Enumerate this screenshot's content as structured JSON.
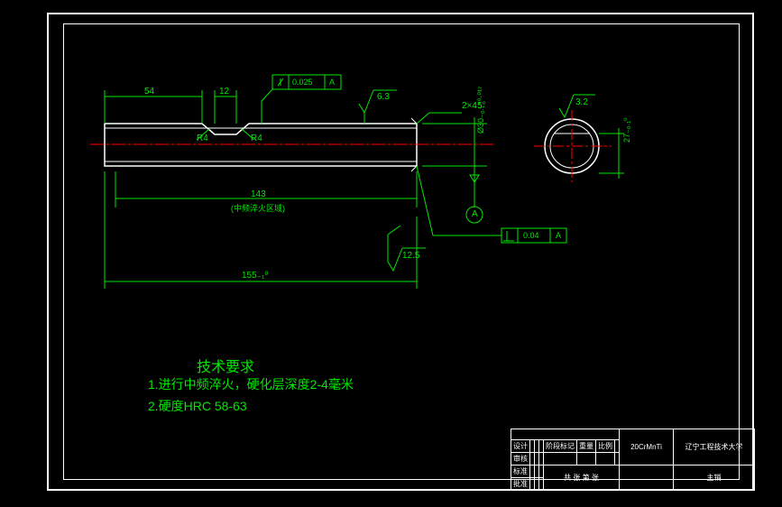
{
  "dims": {
    "d54": "54",
    "d12": "12",
    "r4a": "R4",
    "r4b": "R4",
    "d143": "143",
    "d143note": "(中频淬火区域)",
    "d155": "155₋₁⁰",
    "chamfer": "2×45°",
    "dia30": "Ø30₋₀.₁⁺⁰·⁰¹⁷",
    "sf63": "6.3",
    "sf32": "3.2",
    "sf125": "12.5",
    "d27": "27₋₀.₁⁰",
    "tol1": "0.025",
    "tol1datum": "A",
    "tol2": "0.04",
    "tol2datum": "A",
    "datumA": "A"
  },
  "req": {
    "title": "技术要求",
    "line1": "1.进行中频淬火，硬化层深度2-4毫米",
    "line2": "2.硬度HRC 58-63"
  },
  "tb": {
    "material": "20CrMnTi",
    "org": "辽宁工程技术大学",
    "partname": "主销",
    "h_design": "设计",
    "h_check": "审核",
    "h_std": "标准",
    "h_appr": "批准",
    "h_stage": "阶段标记",
    "h_wt": "重量",
    "h_scale": "比例",
    "h_sheet": "共 张 第 张"
  }
}
